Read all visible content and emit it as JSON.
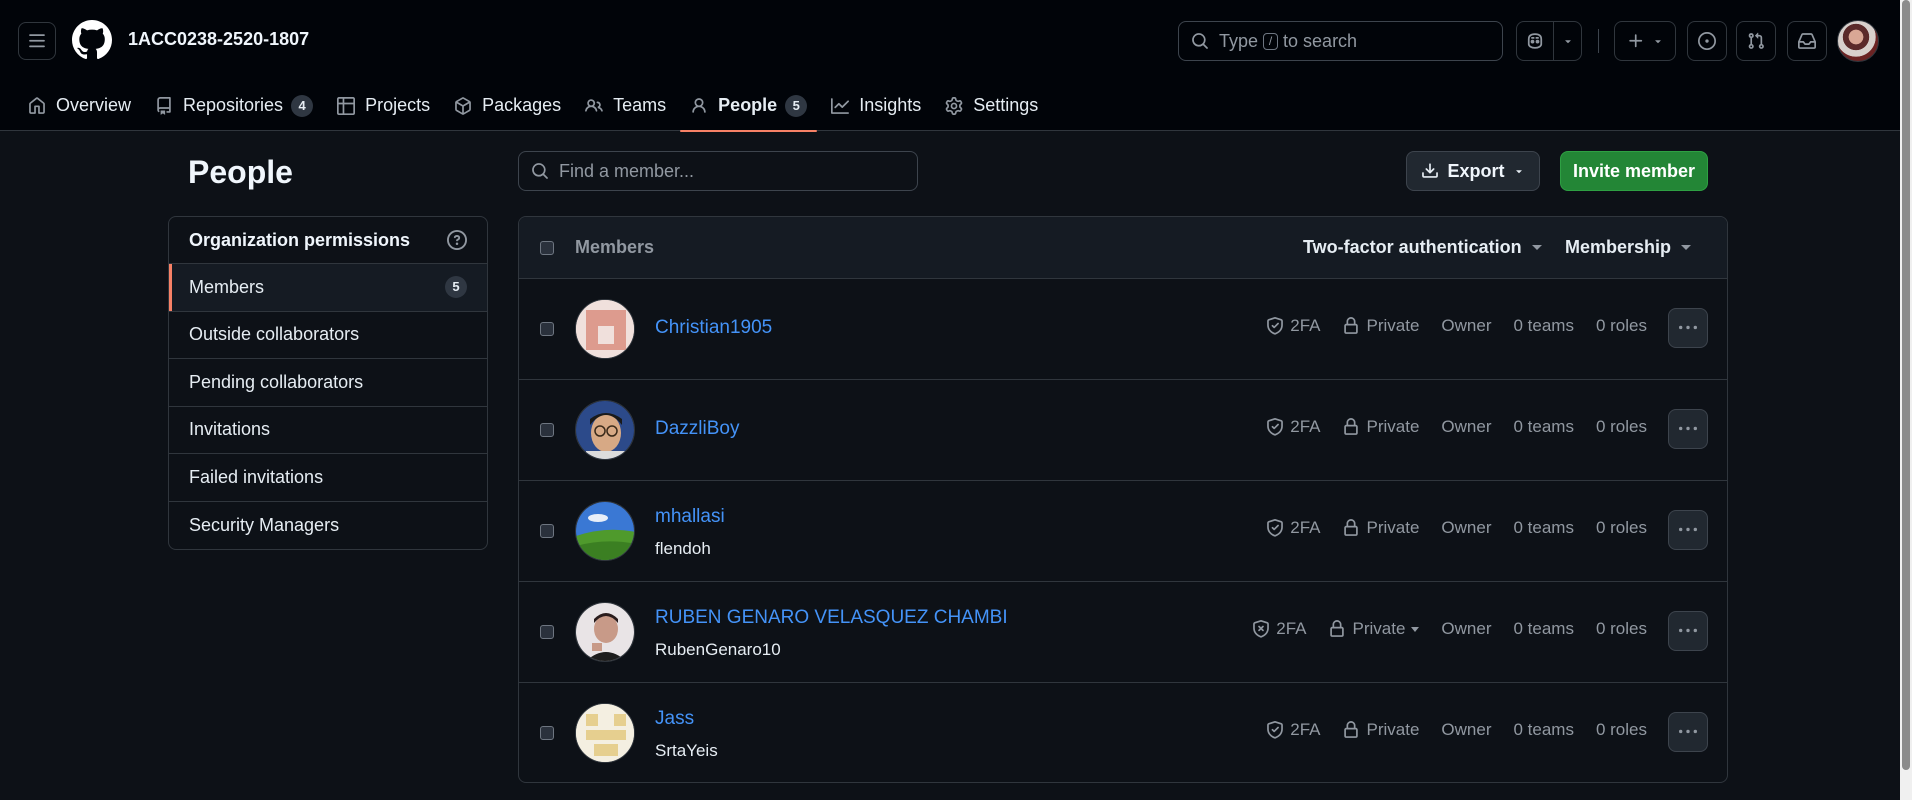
{
  "header": {
    "org_name": "1ACC0238-2520-1807",
    "search_prefix": "Type",
    "search_key": "/",
    "search_suffix": "to search"
  },
  "tabs": [
    {
      "label": "Overview",
      "icon": "home-icon"
    },
    {
      "label": "Repositories",
      "icon": "repo-icon",
      "count": "4"
    },
    {
      "label": "Projects",
      "icon": "table-icon"
    },
    {
      "label": "Packages",
      "icon": "package-icon"
    },
    {
      "label": "Teams",
      "icon": "people-icon"
    },
    {
      "label": "People",
      "icon": "person-icon",
      "count": "5",
      "active": true
    },
    {
      "label": "Insights",
      "icon": "graph-icon"
    },
    {
      "label": "Settings",
      "icon": "gear-icon"
    }
  ],
  "page": {
    "title": "People"
  },
  "sidebar": {
    "heading": "Organization permissions",
    "items": [
      {
        "label": "Members",
        "count": "5",
        "selected": true
      },
      {
        "label": "Outside collaborators"
      },
      {
        "label": "Pending collaborators"
      },
      {
        "label": "Invitations"
      },
      {
        "label": "Failed invitations"
      },
      {
        "label": "Security Managers"
      }
    ]
  },
  "toolbar": {
    "search_placeholder": "Find a member...",
    "export_label": "Export",
    "invite_label": "Invite member"
  },
  "members_table": {
    "header_label": "Members",
    "filter_2fa": "Two-factor authentication",
    "filter_membership": "Membership",
    "rows": [
      {
        "name": "Christian1905",
        "login": "",
        "twofa": "2FA",
        "visibility": "Private",
        "role": "Owner",
        "teams": "0 teams",
        "roles": "0 roles"
      },
      {
        "name": "DazzliBoy",
        "login": "",
        "twofa": "2FA",
        "visibility": "Private",
        "role": "Owner",
        "teams": "0 teams",
        "roles": "0 roles"
      },
      {
        "name": "mhallasi",
        "login": "flendoh",
        "twofa": "2FA",
        "visibility": "Private",
        "role": "Owner",
        "teams": "0 teams",
        "roles": "0 roles"
      },
      {
        "name": "RUBEN GENARO VELASQUEZ CHAMBI",
        "login": "RubenGenaro10",
        "twofa": "2FA",
        "visibility": "Private",
        "role": "Owner",
        "teams": "0 teams",
        "roles": "0 roles"
      },
      {
        "name": "Jass",
        "login": "SrtaYeis",
        "twofa": "2FA",
        "visibility": "Private",
        "role": "Owner",
        "teams": "0 teams",
        "roles": "0 roles"
      }
    ]
  },
  "colors": {
    "background": "#0d1117",
    "header_bg": "#010409",
    "link": "#4493f8",
    "accent_underline": "#f78166",
    "primary_button": "#238636"
  }
}
